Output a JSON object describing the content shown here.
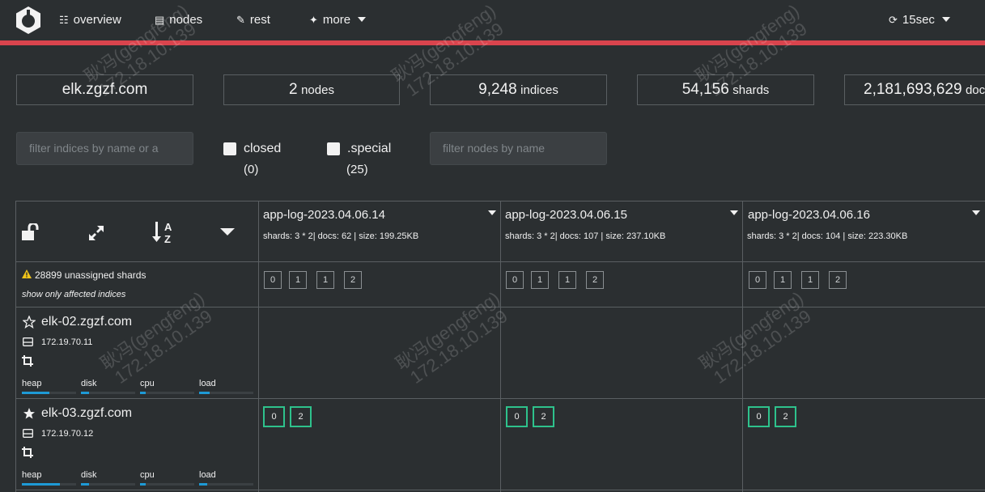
{
  "nav": {
    "overview": "overview",
    "nodes": "nodes",
    "rest": "rest",
    "more": "more",
    "refresh": "15sec"
  },
  "stats": {
    "cluster": "elk.zgzf.com",
    "nodes_count": "2",
    "nodes_label": "nodes",
    "indices_count": "9,248",
    "indices_label": "indices",
    "shards_count": "54,156",
    "shards_label": "shards",
    "docs_count": "2,181,693,629",
    "docs_label": "docs"
  },
  "filters": {
    "indices_placeholder": "filter indices by name or a",
    "closed_label": "closed",
    "closed_count": "(0)",
    "special_label": ".special",
    "special_count": "(25)",
    "nodes_placeholder": "filter nodes by name"
  },
  "indices": [
    {
      "name": "app-log-2023.04.06.14",
      "meta": "shards: 3 * 2| docs: 62 | size: 199.25KB"
    },
    {
      "name": "app-log-2023.04.06.15",
      "meta": "shards: 3 * 2| docs: 107 | size: 237.10KB"
    },
    {
      "name": "app-log-2023.04.06.16",
      "meta": "shards: 3 * 2| docs: 104 | size: 223.30KB"
    }
  ],
  "unassigned": {
    "text": "28899 unassigned shards",
    "link": "show only affected indices",
    "shards": [
      "0",
      "1",
      "1",
      "2"
    ]
  },
  "nodes": [
    {
      "name": "elk-02.zgzf.com",
      "ip": "172.19.70.11",
      "master": false,
      "metrics": {
        "heap": 0.5,
        "disk": 0.15,
        "cpu": 0.1,
        "load": 0.2
      },
      "shards": []
    },
    {
      "name": "elk-03.zgzf.com",
      "ip": "172.19.70.12",
      "master": true,
      "metrics": {
        "heap": 0.7,
        "disk": 0.15,
        "cpu": 0.1,
        "load": 0.15
      },
      "shards": [
        "0",
        "2"
      ]
    }
  ],
  "metric_labels": {
    "heap": "heap",
    "disk": "disk",
    "cpu": "cpu",
    "load": "load"
  },
  "watermark": {
    "line1": "耿冯(gengfeng)",
    "line2": "172.18.10.139"
  },
  "colors": {
    "accent": "#d9444d",
    "started": "#2ec28c",
    "bar": "#1e9ad6",
    "warning": "#f0c419"
  }
}
